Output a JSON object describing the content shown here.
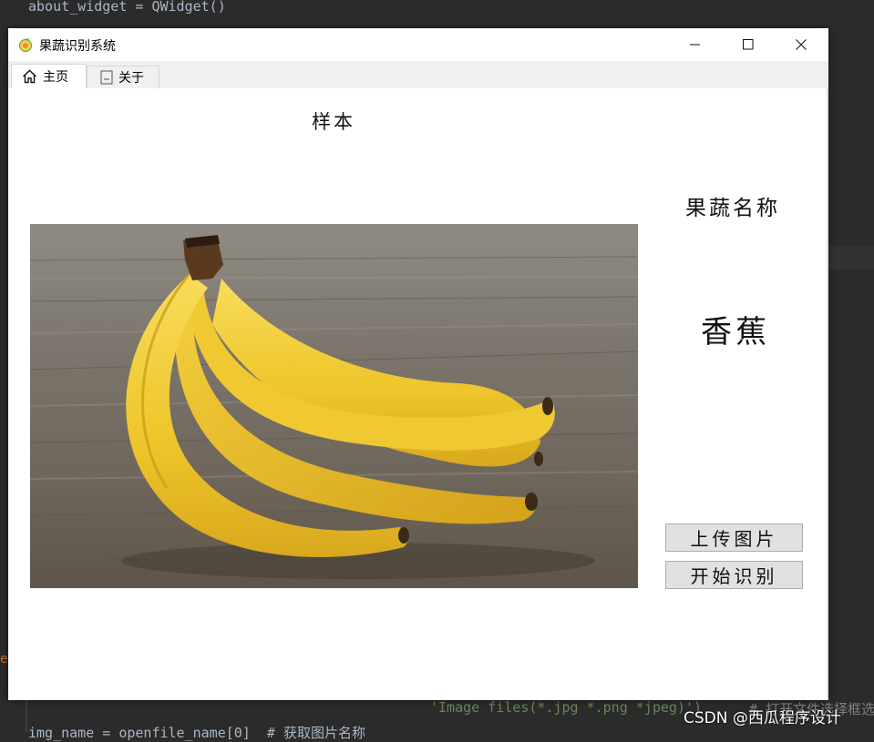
{
  "ide": {
    "top_code": "about_widget = QWidget()",
    "bottom_code": "img_name = openfile_name[0]  # 获取图片名称",
    "string_code": "'Image files(*.jpg *.png *jpeg)')",
    "comment_code": "# 打开文件选择框选"
  },
  "window": {
    "title": "果蔬识别系统",
    "app_icon": "fruit-app-icon",
    "controls": {
      "minimize": "minimize-icon",
      "maximize": "maximize-icon",
      "close": "close-icon"
    }
  },
  "tabs": [
    {
      "label": "主页",
      "icon": "home-icon"
    },
    {
      "label": "关于",
      "icon": "document-icon"
    }
  ],
  "main": {
    "sample_label": "样本",
    "name_label": "果蔬名称",
    "result_text": "香蕉",
    "image_subject": "banana-photo",
    "upload_button": "上传图片",
    "start_button": "开始识别"
  },
  "watermark": "CSDN @西瓜程序设计",
  "colors": {
    "ide_bg": "#2b2b2b",
    "button_bg": "#e1e1e1",
    "tab_bar_bg": "#f0f0f0",
    "banana_yellow": "#f1c92a"
  }
}
